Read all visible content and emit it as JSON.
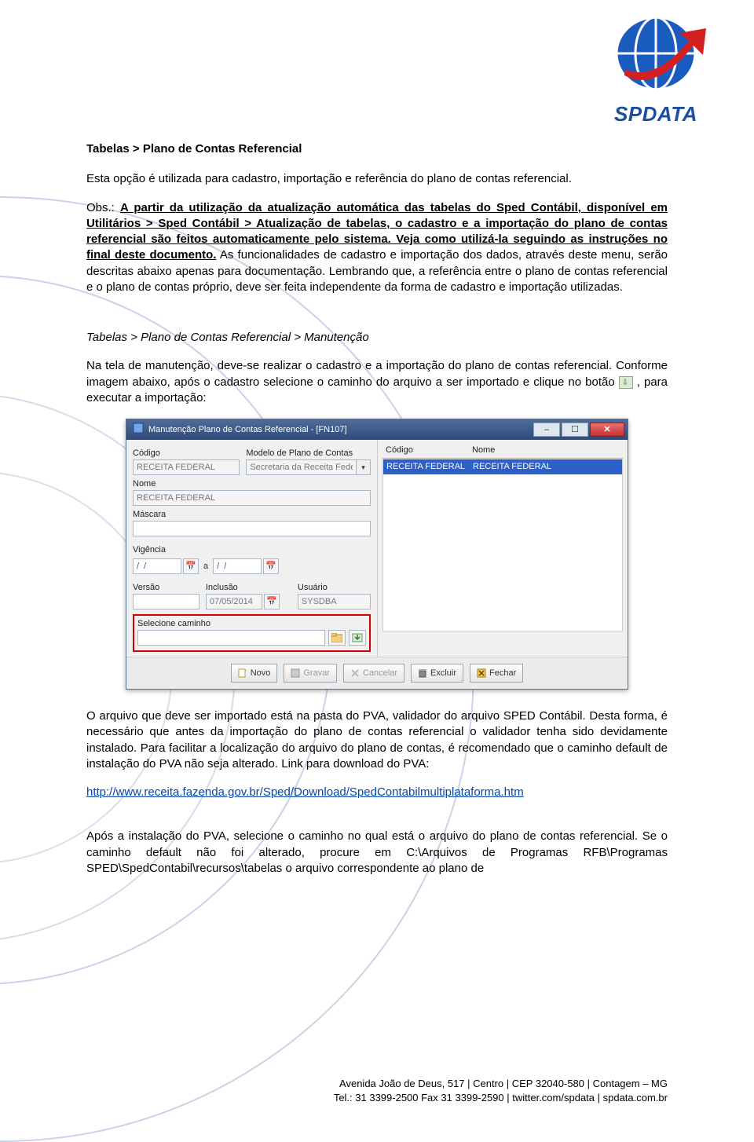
{
  "logo": {
    "brand": "SPDATA"
  },
  "heading": "Tabelas > Plano de Contas Referencial",
  "para1": "Esta opção é utilizada para cadastro, importação e referência do plano de contas referencial.",
  "obs_prefix": "Obs.: ",
  "obs_underline": "A partir da utilização da atualização automática das tabelas do Sped Contábil, disponível em Utilitários > Sped Contábil > Atualização de tabelas, o cadastro e a importação do plano de contas referencial são feitos automaticamente pelo sistema. Veja como utilizá-la seguindo as instruções no final deste documento.",
  "obs_rest": " As funcionalidades de cadastro e importação dos dados, através deste menu, serão descritas abaixo apenas para documentação. Lembrando que, a referência entre o plano de contas referencial e o plano de contas próprio, deve ser feita independente da forma de cadastro e importação utilizadas.",
  "sub_breadcrumb": "Tabelas > Plano de Contas Referencial > Manutenção",
  "para3a": "Na tela de manutenção, deve-se realizar o cadastro e a importação do plano de contas referencial. Conforme imagem abaixo, após o cadastro selecione o caminho do arquivo a ser importado e clique no botão ",
  "para3b": ", para executar a importação:",
  "dialog": {
    "title": "Manutenção Plano de Contas Referencial - [FN107]",
    "labels": {
      "codigo": "Código",
      "modelo": "Modelo de Plano de Contas",
      "nome": "Nome",
      "mascara": "Máscara",
      "vigencia": "Vigência",
      "versao": "Versão",
      "inclusao": "Inclusão",
      "usuario": "Usuário",
      "selecione": "Selecione caminho",
      "a": "a"
    },
    "values": {
      "codigo": "RECEITA FEDERAL",
      "modelo": "Secretaria da Receita Federa",
      "nome": "RECEITA FEDERAL",
      "mascara": "",
      "vigencia_from": "/  /",
      "vigencia_to": "/  /",
      "versao": "",
      "inclusao": "07/05/2014",
      "usuario": "SYSDBA",
      "path": ""
    },
    "list": {
      "col_codigo": "Código",
      "col_nome": "Nome",
      "row_code": "RECEITA FEDERAL",
      "row_name": "RECEITA FEDERAL"
    },
    "buttons": {
      "novo": "Novo",
      "gravar": "Gravar",
      "cancelar": "Cancelar",
      "excluir": "Excluir",
      "fechar": "Fechar"
    }
  },
  "para4": "O arquivo que deve ser importado está na pasta do PVA, validador do arquivo SPED Contábil. Desta forma, é necessário que antes da importação do plano de contas referencial o validador tenha sido devidamente instalado. Para facilitar a localização do arquivo do plano de contas, é recomendado que o caminho default de instalação do PVA não seja alterado. Link para download do PVA:",
  "link": "http://www.receita.fazenda.gov.br/Sped/Download/SpedContabilmultiplataforma.htm",
  "para5": "Após a instalação do PVA, selecione o caminho no qual está o arquivo do plano de contas referencial. Se o caminho default não foi alterado, procure em C:\\Arquivos de Programas RFB\\Programas SPED\\SpedContabil\\recursos\\tabelas o arquivo correspondente ao plano de",
  "footer": {
    "line1": "Avenida João de Deus, 517 | Centro | CEP 32040-580 | Contagem – MG",
    "line2": "Tel.: 31 3399-2500 Fax 31 3399-2590 | twitter.com/spdata | spdata.com.br"
  }
}
